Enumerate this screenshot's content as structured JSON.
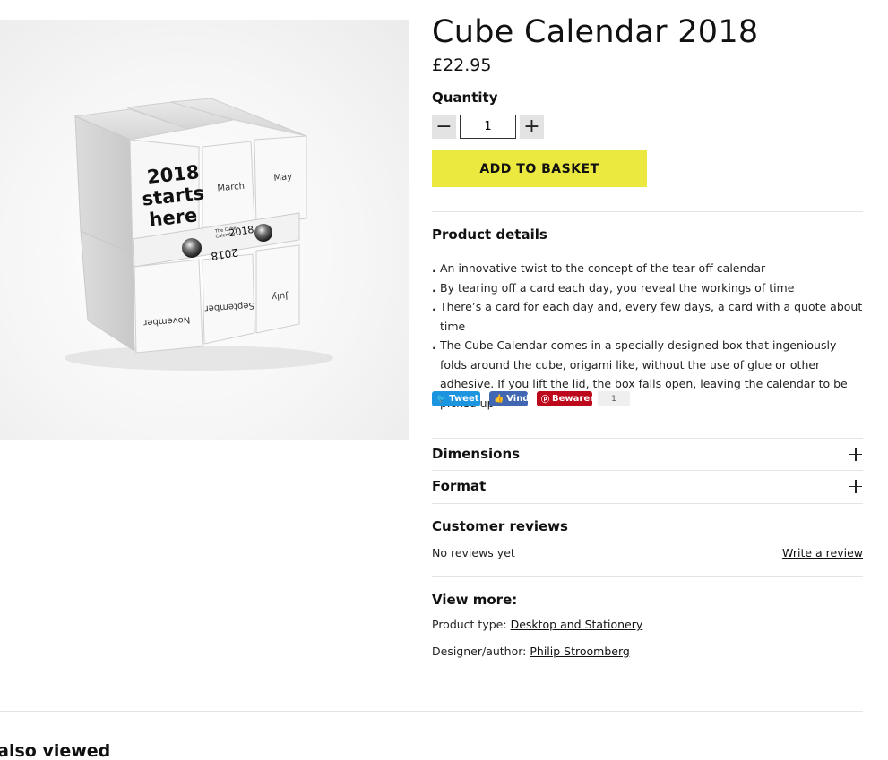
{
  "product": {
    "title": "Cube Calendar 2018",
    "price": "£22.95",
    "image_text": {
      "starts_line1": "2018",
      "starts_line2": "starts",
      "starts_line3": "here",
      "march": "March",
      "may": "May",
      "band_line1": "The Cube",
      "band_line2": "Calendar",
      "band_year": "2018",
      "november": "November",
      "september": "September",
      "july": "July"
    }
  },
  "quantity": {
    "label": "Quantity",
    "value": "1",
    "minus_icon": "minus-icon",
    "plus_icon": "plus-icon"
  },
  "add_to_basket": {
    "label": "ADD TO BASKET",
    "color": "#ebe83f"
  },
  "details": {
    "title": "Product details",
    "items": [
      "An innovative twist to the concept of the tear-off calendar",
      "By tearing off a card each day, you reveal the workings of time",
      "There’s a card for each day and, every few days, a card with a quote about time",
      "The Cube Calendar comes in a specially designed box that ingeniously folds around the cube, origami like, without the use of glue or other adhesive. If you lift the lid, the box falls open, leaving the calendar to be picked up"
    ]
  },
  "share": {
    "tweet": "Tweet",
    "vind": "Vind",
    "pin": "Bewaren",
    "pin_count": "1",
    "colors": {
      "twitter": "#1b95e0",
      "facebook": "#4267b2",
      "pinterest": "#bd081c"
    }
  },
  "accordions": [
    {
      "label": "Dimensions"
    },
    {
      "label": "Format"
    }
  ],
  "reviews": {
    "title": "Customer reviews",
    "empty_text": "No reviews yet",
    "write_link": "Write a review"
  },
  "view_more": {
    "title": "View more:",
    "product_type_label": "Product type:",
    "product_type_value": "Desktop and Stationery",
    "designer_label": "Designer/author:",
    "designer_value": "Philip Stroomberg"
  },
  "also_viewed": {
    "title": "u also viewed"
  }
}
